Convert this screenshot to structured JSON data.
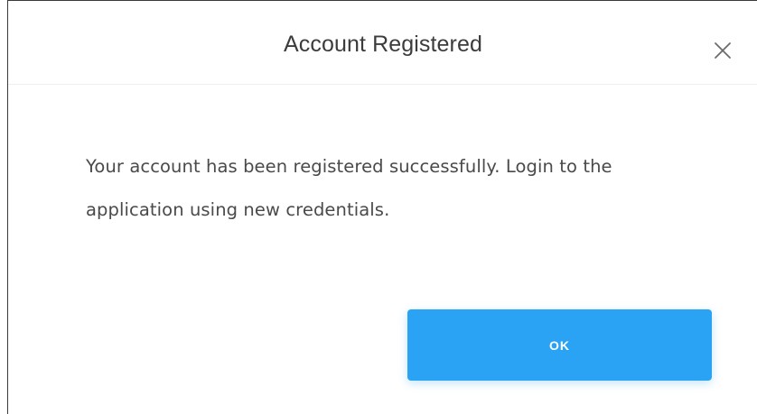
{
  "dialog": {
    "title": "Account Registered",
    "close_icon": "close-icon",
    "message": "Your account has been registered successfully. Login to the application using new credentials.",
    "ok_label": "OK"
  },
  "colors": {
    "accent": "#2aa3f5",
    "title_text": "#3c3c3c",
    "body_text": "#4a4a4a",
    "button_text": "#ffffff"
  }
}
